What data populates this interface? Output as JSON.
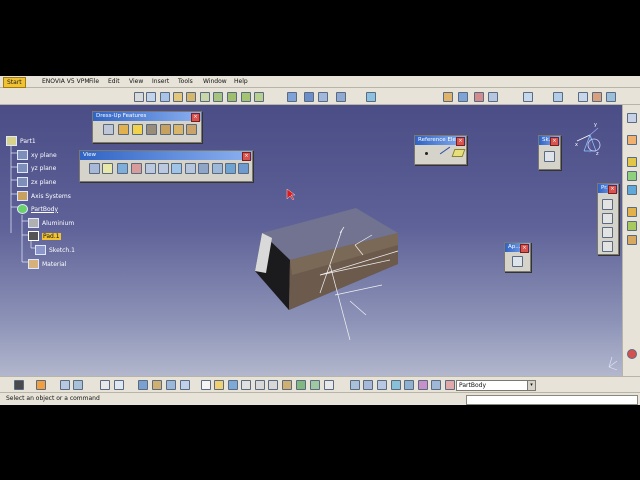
{
  "menu": {
    "start": "Start",
    "items": [
      "ENOVIA V5 VPM",
      "File",
      "Edit",
      "View",
      "Insert",
      "Tools",
      "Window",
      "Help"
    ]
  },
  "tree": {
    "root": "Part1",
    "planes": [
      "xy plane",
      "yz plane",
      "zx plane"
    ],
    "axis_systems": "Axis Systems",
    "body": "PartBody",
    "material_applied": "Aluminium",
    "pad": "Pad.1",
    "sketch": "Sketch.1",
    "material": "Material"
  },
  "toolbars": {
    "dressup": "Dress-Up Features",
    "view": "View",
    "reference": "Reference Ele...",
    "sketch_short": "Sk...",
    "apply_short": "Ap...",
    "part_short": "Pr..."
  },
  "bottom": {
    "selector_value": "PartBody"
  },
  "status": {
    "message": "Select an object or a command"
  },
  "colors": {
    "viewport_top": "#4b4d86",
    "viewport_bottom": "#b2b7cd",
    "highlight": "#f1c232",
    "title_blue": "#2f63c4"
  }
}
